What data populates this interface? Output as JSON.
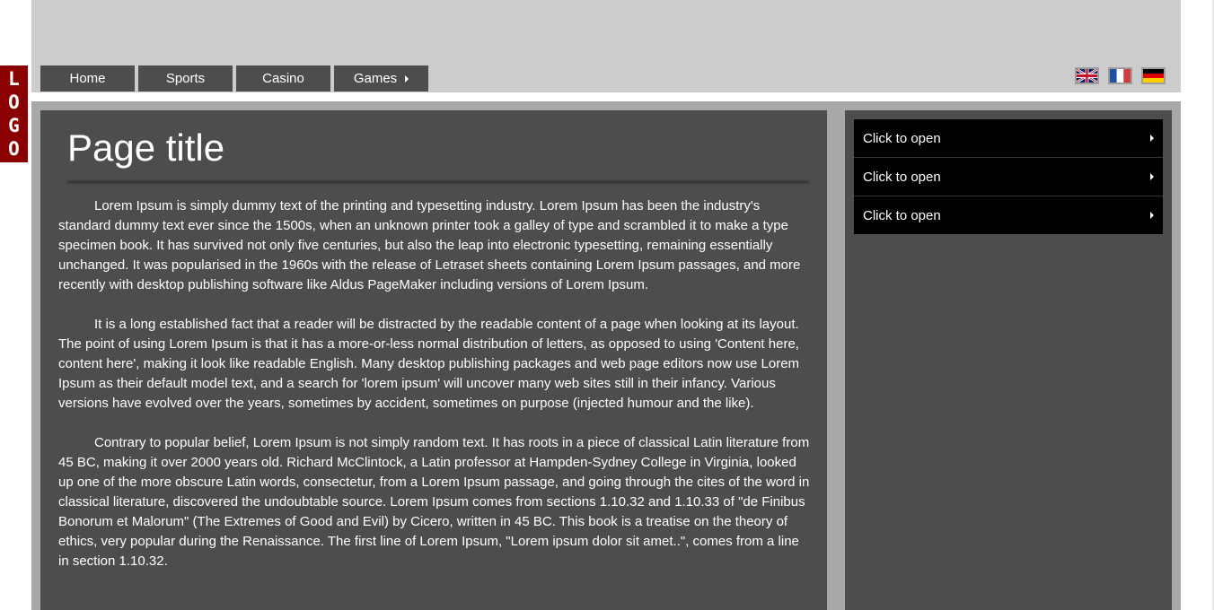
{
  "logo": {
    "text": "LOGO",
    "letters": [
      "L",
      "O",
      "G",
      "O"
    ],
    "color": "#8b0000"
  },
  "nav": {
    "items": [
      {
        "label": "Home"
      },
      {
        "label": "Sports"
      },
      {
        "label": "Casino"
      },
      {
        "label": "Games",
        "has_submenu": true
      }
    ]
  },
  "languages": [
    {
      "code": "en",
      "icon": "uk-flag-icon"
    },
    {
      "code": "fr",
      "icon": "france-flag-icon"
    },
    {
      "code": "de",
      "icon": "germany-flag-icon"
    }
  ],
  "main": {
    "title": "Page title",
    "paragraphs": [
      "Lorem Ipsum is simply dummy text of the printing and typesetting industry. Lorem Ipsum has been the industry's standard dummy text ever since the 1500s, when an unknown printer took a galley of type and scrambled it to make a type specimen book. It has survived not only five centuries, but also the leap into electronic typesetting, remaining essentially unchanged. It was popularised in the 1960s with the release of Letraset sheets containing Lorem Ipsum passages, and more recently with desktop publishing software like Aldus PageMaker including versions of Lorem Ipsum.",
      "It is a long established fact that a reader will be distracted by the readable content of a page when looking at its layout. The point of using Lorem Ipsum is that it has a more-or-less normal distribution of letters, as opposed to using 'Content here, content here', making it look like readable English. Many desktop publishing packages and web page editors now use Lorem Ipsum as their default model text, and a search for 'lorem ipsum' will uncover many web sites still in their infancy. Various versions have evolved over the years, sometimes by accident, sometimes on purpose (injected humour and the like).",
      "Contrary to popular belief, Lorem Ipsum is not simply random text. It has roots in a piece of classical Latin literature from 45 BC, making it over 2000 years old. Richard McClintock, a Latin professor at Hampden-Sydney College in Virginia, looked up one of the more obscure Latin words, consectetur, from a Lorem Ipsum passage, and going through the cites of the word in classical literature, discovered the undoubtable source. Lorem Ipsum comes from sections 1.10.32 and 1.10.33 of \"de Finibus Bonorum et Malorum\" (The Extremes of Good and Evil) by Cicero, written in 45 BC. This book is a treatise on the theory of ethics, very popular during the Renaissance. The first line of Lorem Ipsum, \"Lorem ipsum dolor sit amet..\", comes from a line in section 1.10.32."
    ]
  },
  "sidebar": {
    "accordion": [
      {
        "label": "Click to open"
      },
      {
        "label": "Click to open"
      },
      {
        "label": "Click to open"
      }
    ]
  },
  "colors": {
    "header_bg": "#cccccc",
    "panel_bg": "#4d4d4d",
    "frame_bg": "#a8a8a8",
    "accordion_bg": "#000000",
    "logo_bg": "#8b0000"
  }
}
